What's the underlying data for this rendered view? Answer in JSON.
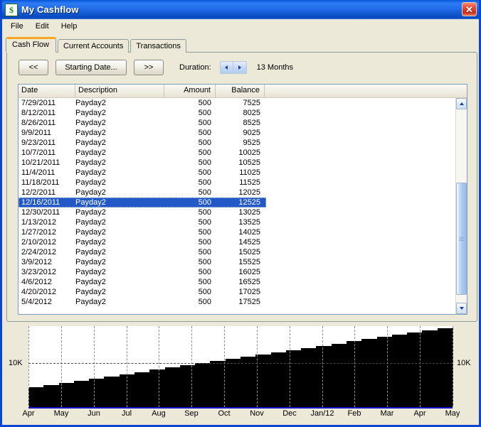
{
  "window": {
    "title": "My Cashflow",
    "icon": "dollar-icon",
    "icon_glyph": "$",
    "close_label": "✕",
    "border_color": "#0a46d2",
    "titlebar_color": "#1f6ae6"
  },
  "menu": {
    "items": [
      {
        "label": "File"
      },
      {
        "label": "Edit"
      },
      {
        "label": "Help"
      }
    ]
  },
  "tabs": {
    "active_index": 0,
    "active_accent": "#f5a623",
    "items": [
      {
        "label": "Cash Flow"
      },
      {
        "label": "Current Accounts"
      },
      {
        "label": "Transactions"
      }
    ]
  },
  "toolbar": {
    "prev_label": "<<",
    "starting_date_label": "Starting Date...",
    "next_label": ">>",
    "duration_label": "Duration:",
    "spin_down_icon": "triangle-left-icon",
    "spin_up_icon": "triangle-right-icon",
    "duration_value": "13 Months"
  },
  "table": {
    "columns": [
      "Date",
      "Description",
      "Amount",
      "Balance"
    ],
    "selected_index": 10,
    "selection_color": "#2359c6",
    "rows": [
      {
        "date": "7/29/2011",
        "description": "Payday2",
        "amount": "500",
        "balance": "7525"
      },
      {
        "date": "8/12/2011",
        "description": "Payday2",
        "amount": "500",
        "balance": "8025"
      },
      {
        "date": "8/26/2011",
        "description": "Payday2",
        "amount": "500",
        "balance": "8525"
      },
      {
        "date": "9/9/2011",
        "description": "Payday2",
        "amount": "500",
        "balance": "9025"
      },
      {
        "date": "9/23/2011",
        "description": "Payday2",
        "amount": "500",
        "balance": "9525"
      },
      {
        "date": "10/7/2011",
        "description": "Payday2",
        "amount": "500",
        "balance": "10025"
      },
      {
        "date": "10/21/2011",
        "description": "Payday2",
        "amount": "500",
        "balance": "10525"
      },
      {
        "date": "11/4/2011",
        "description": "Payday2",
        "amount": "500",
        "balance": "11025"
      },
      {
        "date": "11/18/2011",
        "description": "Payday2",
        "amount": "500",
        "balance": "11525"
      },
      {
        "date": "12/2/2011",
        "description": "Payday2",
        "amount": "500",
        "balance": "12025"
      },
      {
        "date": "12/16/2011",
        "description": "Payday2",
        "amount": "500",
        "balance": "12525"
      },
      {
        "date": "12/30/2011",
        "description": "Payday2",
        "amount": "500",
        "balance": "13025"
      },
      {
        "date": "1/13/2012",
        "description": "Payday2",
        "amount": "500",
        "balance": "13525"
      },
      {
        "date": "1/27/2012",
        "description": "Payday2",
        "amount": "500",
        "balance": "14025"
      },
      {
        "date": "2/10/2012",
        "description": "Payday2",
        "amount": "500",
        "balance": "14525"
      },
      {
        "date": "2/24/2012",
        "description": "Payday2",
        "amount": "500",
        "balance": "15025"
      },
      {
        "date": "3/9/2012",
        "description": "Payday2",
        "amount": "500",
        "balance": "15525"
      },
      {
        "date": "3/23/2012",
        "description": "Payday2",
        "amount": "500",
        "balance": "16025"
      },
      {
        "date": "4/6/2012",
        "description": "Payday2",
        "amount": "500",
        "balance": "16525"
      },
      {
        "date": "4/20/2012",
        "description": "Payday2",
        "amount": "500",
        "balance": "17025"
      },
      {
        "date": "5/4/2012",
        "description": "Payday2",
        "amount": "500",
        "balance": "17525"
      }
    ]
  },
  "scrollbar": {
    "up_icon": "chevron-up-icon",
    "down_icon": "chevron-down-icon",
    "thumb_top_pct": 38,
    "thumb_height_pct": 58
  },
  "chart_data": {
    "type": "area",
    "title": "",
    "xlabel": "",
    "ylabel": "",
    "grid": true,
    "legend": null,
    "y_tick_labels": [
      "10K"
    ],
    "y_tick_values": [
      10000
    ],
    "ylim": [
      0,
      18500
    ],
    "axis_label_left": "10K",
    "axis_label_right": "10K",
    "series_color": "#000000",
    "categories": [
      "Apr",
      "May",
      "Jun",
      "Jul",
      "Aug",
      "Sep",
      "Oct",
      "Nov",
      "Dec",
      "Jan/12",
      "Feb",
      "Mar",
      "Apr",
      "May"
    ],
    "x": [
      "4/2011",
      "4/2011",
      "5/2011",
      "5/2011",
      "6/2011",
      "6/2011",
      "7/2011",
      "7/2011",
      "8/2011",
      "8/2011",
      "9/2011",
      "9/2011",
      "10/2011",
      "10/2011",
      "11/2011",
      "11/2011",
      "12/2011",
      "12/2011",
      "1/2012",
      "1/2012",
      "2/2012",
      "2/2012",
      "3/2012",
      "3/2012",
      "4/2012",
      "4/2012",
      "5/2012",
      "5/2012"
    ],
    "values": [
      4525,
      5025,
      5525,
      6025,
      6525,
      7025,
      7525,
      8025,
      8525,
      9025,
      9525,
      10025,
      10525,
      11025,
      11525,
      12025,
      12525,
      13025,
      13525,
      14025,
      14525,
      15025,
      15525,
      16025,
      16525,
      17025,
      17525,
      18025
    ]
  }
}
